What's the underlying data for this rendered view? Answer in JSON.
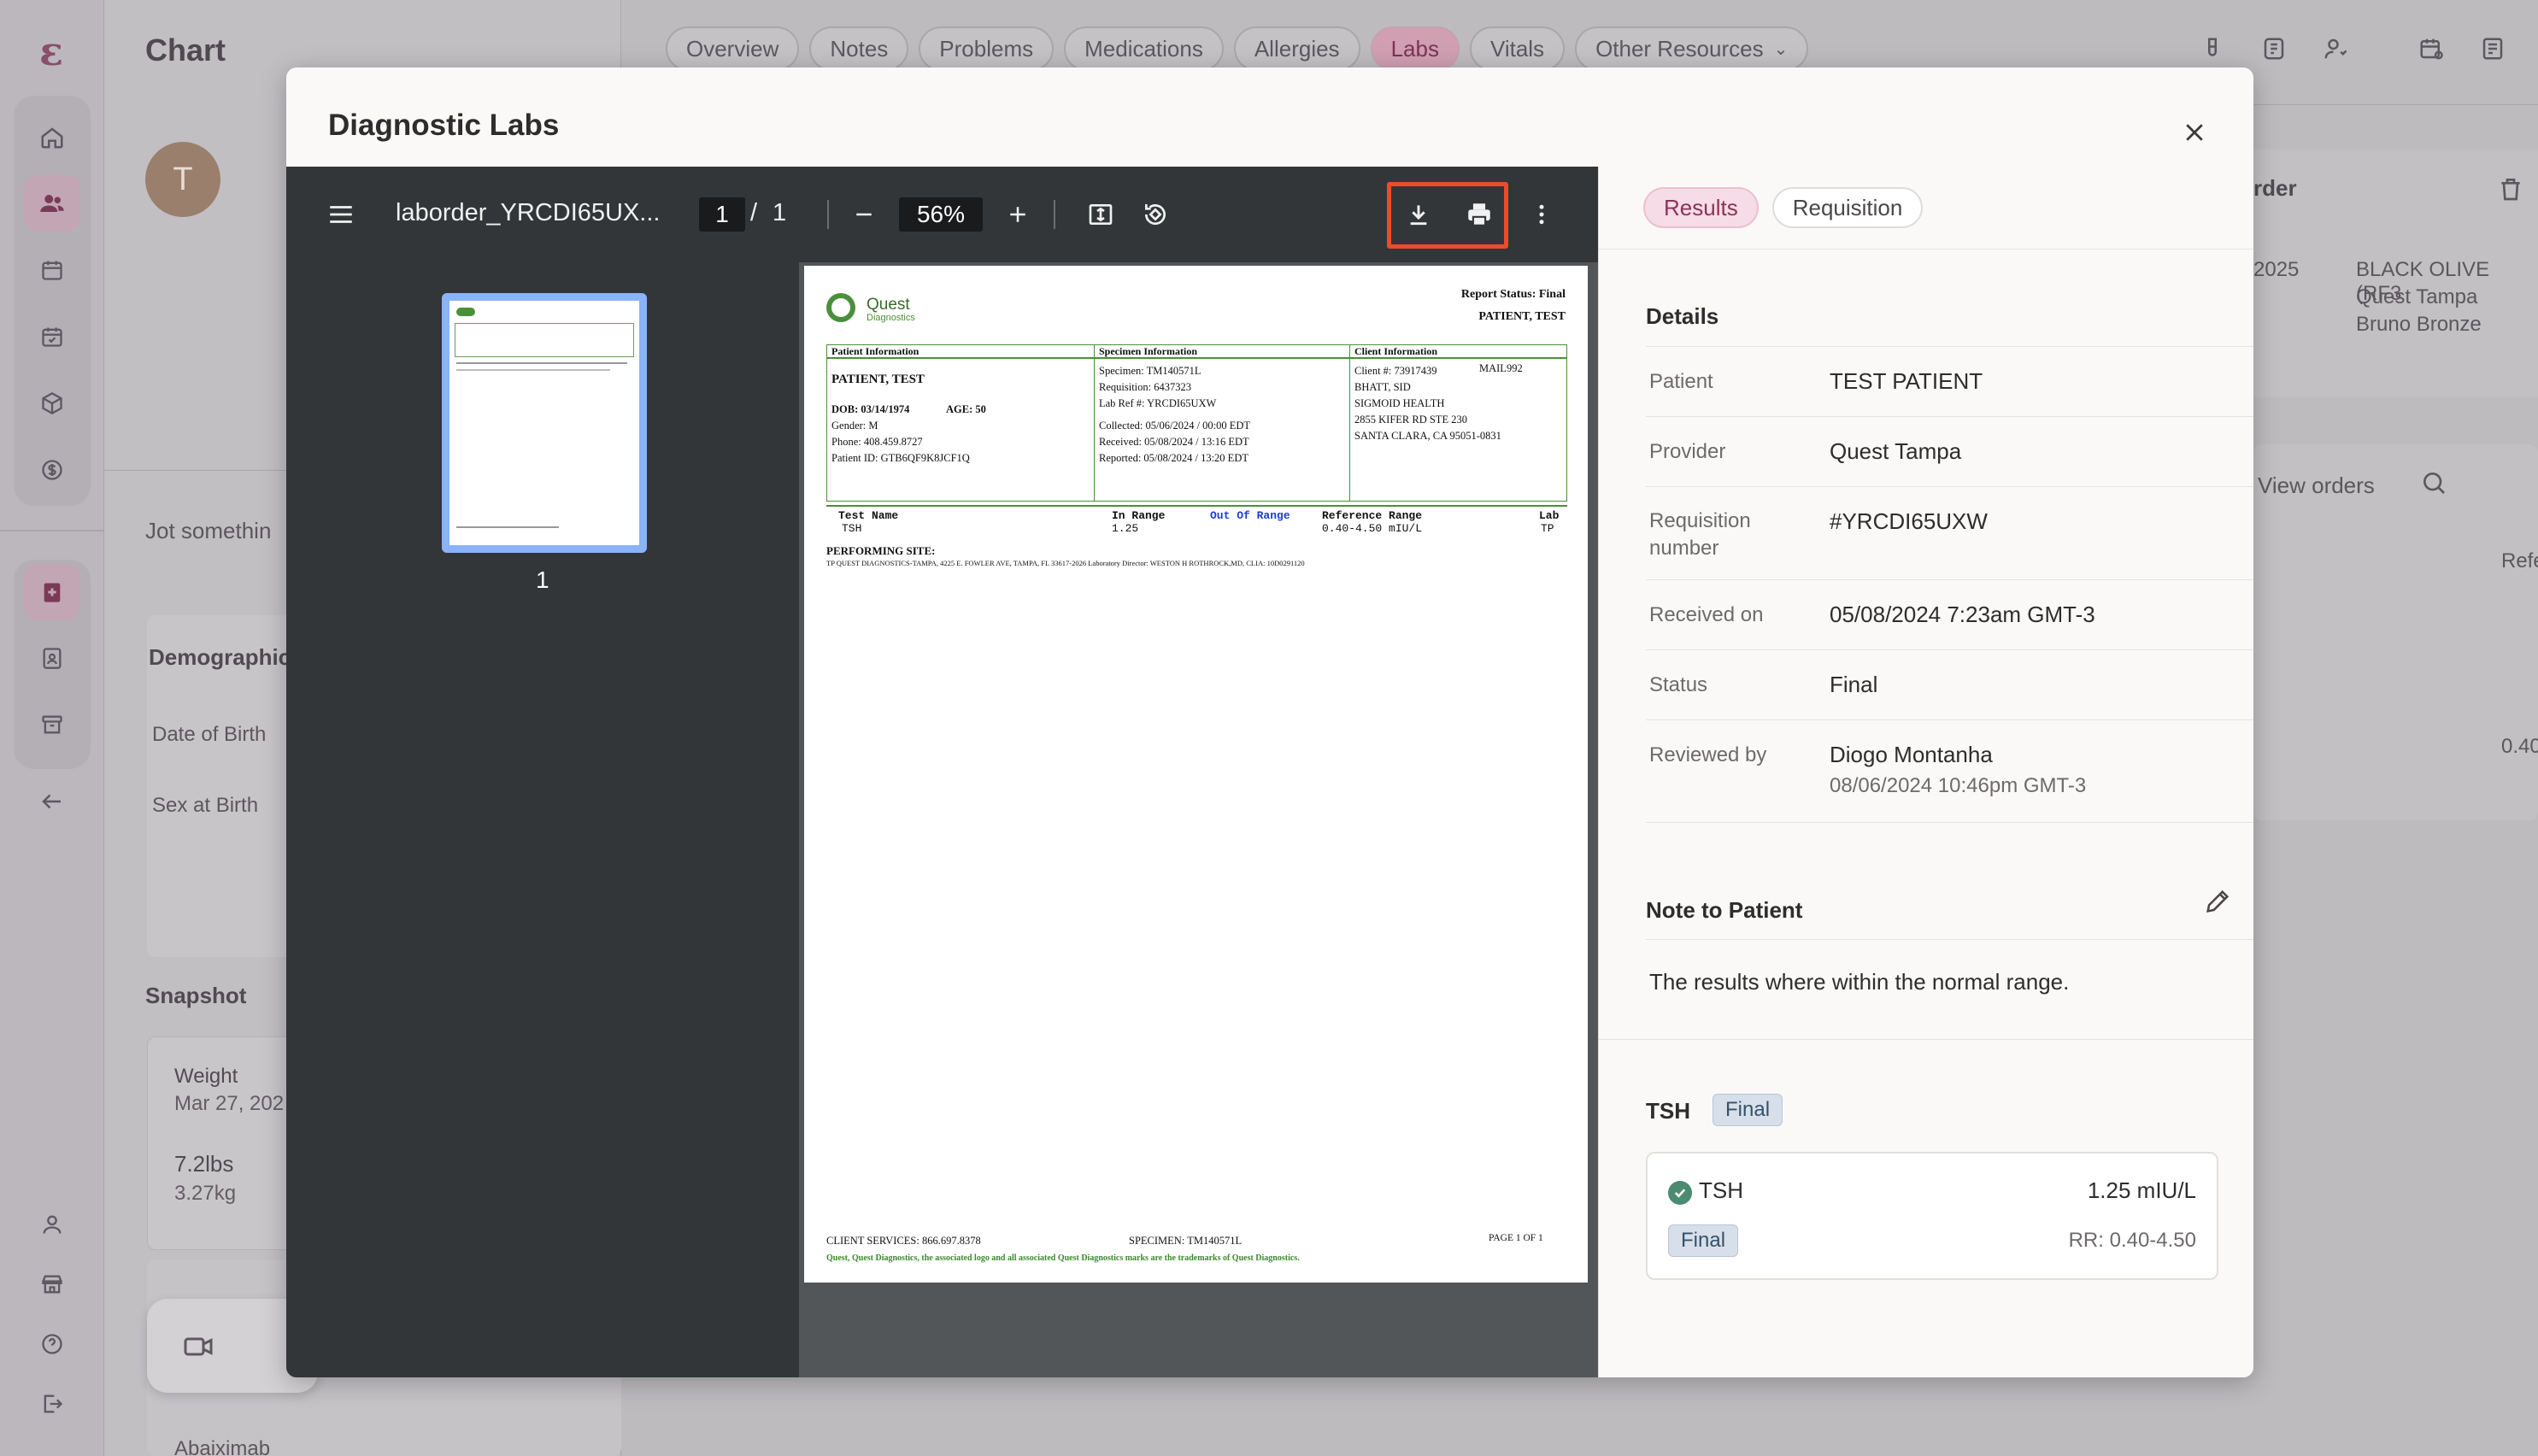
{
  "app": {
    "page_title": "Chart",
    "patient_initial": "T",
    "jot_placeholder": "Jot somethin",
    "demographics_title": "Demographic",
    "dob_label": "Date of Birth",
    "sex_label": "Sex at Birth",
    "snapshot_title": "Snapshot",
    "weight_label": "Weight",
    "weight_date": "Mar 27, 202",
    "weight_lbs": "7.2lbs",
    "weight_kg": "3.27kg",
    "bottom_name": "Abaiximab",
    "tabs": [
      "Overview",
      "Notes",
      "Problems",
      "Medications",
      "Allergies",
      "Labs",
      "Vitals",
      "Other Resources"
    ],
    "right_bg": {
      "order": "rder",
      "year": "2025",
      "item1": "BLACK OLIVE (RF3",
      "item2": "Quest Tampa",
      "item3": "Bruno Bronze",
      "view_orders": "View orders",
      "ref": "Refe",
      "value": "0.40"
    }
  },
  "modal": {
    "title": "Diagnostic Labs",
    "viewer": {
      "filename": "laborder_YRCDI65UX...",
      "page_current": "1",
      "page_sep": "/",
      "page_total": "1",
      "zoom": "56%",
      "thumb_page": "1"
    },
    "pdf": {
      "logo": "Quest",
      "logo_sub": "Diagnostics",
      "report_status": "Report Status: Final",
      "patient_header": "PATIENT, TEST",
      "col_patient": "Patient Information",
      "col_specimen": "Specimen Information",
      "col_client": "Client Information",
      "patient_name": "PATIENT, TEST",
      "dob": "DOB: 03/14/1974",
      "age": "AGE: 50",
      "gender": "Gender:      M",
      "phone": "Phone:       408.459.8727",
      "patient_id": "Patient ID:  GTB6QF9K8JCF1Q",
      "specimen": "Specimen:     TM140571L",
      "requisition": "Requisition:  6437323",
      "lab_ref": "Lab Ref #:     YRCDI65UXW",
      "collected": "Collected:    05/06/2024  / 00:00 EDT",
      "received": "Received:     05/08/2024  / 13:16 EDT",
      "reported": "Reported:     05/08/2024  / 13:20 EDT",
      "client_num": "Client #:  73917439",
      "mail": "MAIL992",
      "client_name": "BHATT, SID",
      "client_org": "SIGMOID HEALTH",
      "client_addr1": "2855 KIFER RD STE 230",
      "client_addr2": "SANTA CLARA, CA 95051-0831",
      "h_test": "Test Name",
      "h_in": "In Range",
      "h_out": "Out Of Range",
      "h_ref": "Reference Range",
      "h_lab": "Lab",
      "r_test": "TSH",
      "r_in": "1.25",
      "r_ref": "0.40-4.50 mIU/L",
      "r_lab": "TP",
      "performing_site": "PERFORMING SITE:",
      "site_detail": "TP      QUEST DIAGNOSTICS-TAMPA, 4225 E. FOWLER AVE, TAMPA, FL 33617-2026 Laboratory Director: WESTON H ROTHROCK,MD, CLIA: 10D0291120",
      "client_services": "CLIENT SERVICES: 866.697.8378",
      "footer_specimen": "SPECIMEN: TM140571L",
      "page_of": "PAGE 1 OF 1",
      "trademark": "Quest, Quest Diagnostics, the associated logo and all associated Quest Diagnostics marks are the trademarks of Quest Diagnostics."
    },
    "details": {
      "tab_results": "Results",
      "tab_requisition": "Requisition",
      "heading": "Details",
      "patient_label": "Patient",
      "patient_value": "TEST PATIENT",
      "provider_label": "Provider",
      "provider_value": "Quest Tampa",
      "requisition_label": "Requisition number",
      "requisition_value": "#YRCDI65UXW",
      "received_label": "Received on",
      "received_value": "05/08/2024 7:23am GMT-3",
      "status_label": "Status",
      "status_value": "Final",
      "reviewed_label": "Reviewed by",
      "reviewed_name": "Diogo Montanha",
      "reviewed_date": "08/06/2024 10:46pm GMT-3",
      "note_heading": "Note to Patient",
      "note_text": "The results where within the normal range.",
      "test_heading": "TSH",
      "test_badge": "Final",
      "result_name": "TSH",
      "result_value": "1.25 mIU/L",
      "result_badge": "Final",
      "result_range": "RR: 0.40-4.50"
    }
  }
}
